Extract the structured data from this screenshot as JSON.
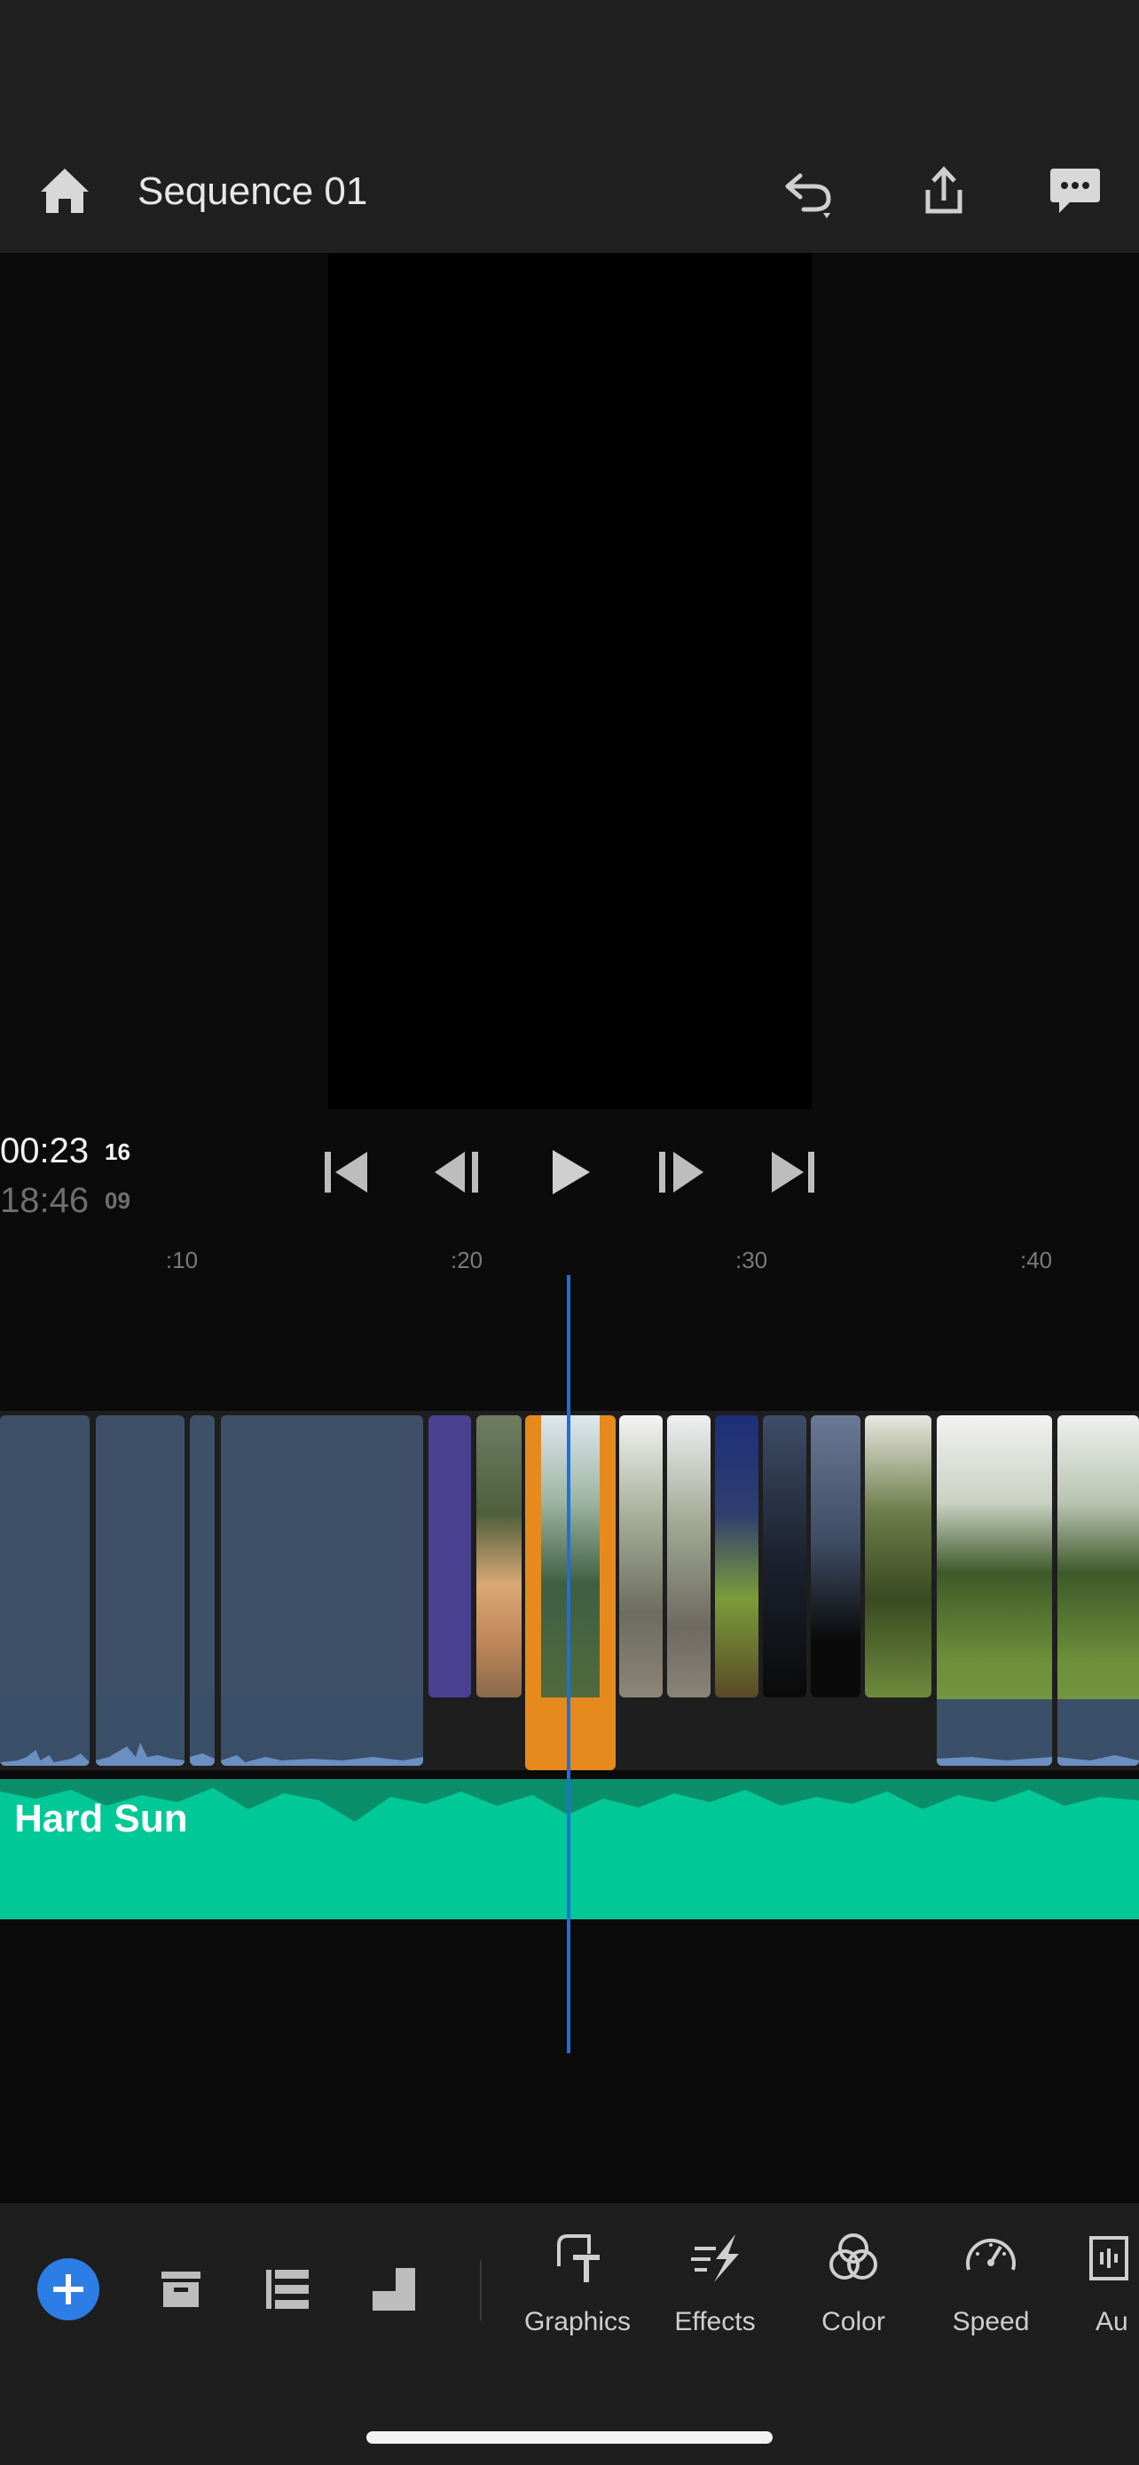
{
  "header": {
    "title": "Sequence 01"
  },
  "transport": {
    "current_time": "00:23",
    "current_frames": "16",
    "total_time": "18:46",
    "total_frames": "09"
  },
  "ruler": {
    "ticks": [
      ":10",
      ":20",
      ":30",
      ":40"
    ]
  },
  "audio": {
    "track_label": "Hard Sun"
  },
  "toolbar": {
    "tools": [
      {
        "label": "Graphics",
        "icon": "graphics-icon"
      },
      {
        "label": "Effects",
        "icon": "effects-icon"
      },
      {
        "label": "Color",
        "icon": "color-icon"
      },
      {
        "label": "Speed",
        "icon": "speed-icon"
      },
      {
        "label": "Au",
        "icon": "audio-icon"
      }
    ]
  },
  "colors": {
    "accent": "#2d7de6",
    "playhead": "#1e6fe0",
    "selected_clip": "#e68a1e",
    "audio_track": "#00c896"
  }
}
